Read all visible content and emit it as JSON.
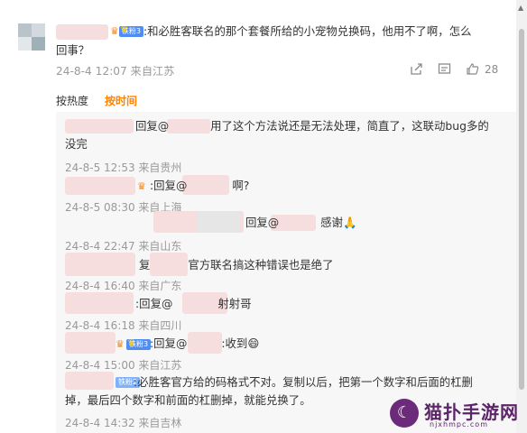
{
  "main_comment": {
    "text_line1": ":和必胜客联名的那个套餐所给的小宠物兑换码，他用不了啊，怎么",
    "text_line2": "回事？",
    "badge": "铁粉3",
    "meta": "24-8-4 12:07 来自江苏",
    "like_count": "28",
    "icons": [
      "share-icon",
      "comment-icon",
      "like-icon"
    ]
  },
  "sort_tabs": {
    "by_popularity": "按热度",
    "by_time": "按时间"
  },
  "replies": [
    {
      "line1": "回复@",
      "line1b": "用了这个方法说还是无法处理，简直了，这联动bug多的",
      "line2": "没完",
      "meta": "24-8-5 12:53 来自贵州"
    },
    {
      "line1": ":回复@",
      "line1b": "啊?",
      "meta": "24-8-5 08:30 来自上海"
    },
    {
      "line1": "回复@",
      "line1b": "感谢",
      "emoji": "🙏",
      "meta": "24-8-4 22:47 来自山东"
    },
    {
      "line1": "复",
      "line1b": "官方联名搞这种错误也是绝了",
      "meta": "24-8-4 16:40 来自广东"
    },
    {
      "line1": ":回复@",
      "line1b": "射射哥",
      "meta": "24-8-4 16:18 来自四川"
    },
    {
      "line1": ":回复@",
      "line1b": ":收到",
      "emoji": "😄",
      "badge": "铁粉3",
      "meta": "24-8-4 15:00 来自江苏"
    },
    {
      "line1": ":必胜客官方给的码格式不对。复制以后，把第一个数字和后面的杠删",
      "line2": "掉，最后四个数字和前面的杠删掉，就能兑换了。",
      "badge": "铁粉2",
      "meta": "24-8-4 14:32 来自吉林"
    }
  ],
  "watermark": {
    "title": "猫扑手游网",
    "url": "njxhmpc.com"
  },
  "colors": {
    "accent": "#ff8200",
    "meta_gray": "#999999",
    "reply_bg": "#f7f7f7",
    "badge_blue": "#4f8df5"
  }
}
